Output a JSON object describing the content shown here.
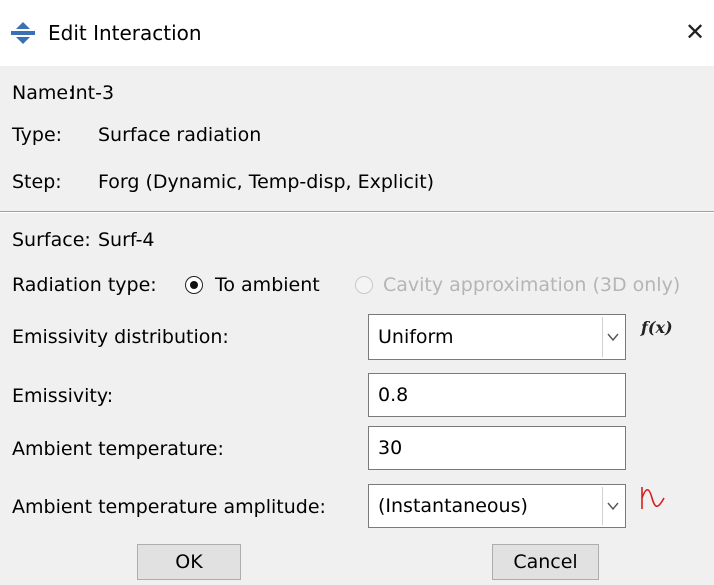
{
  "window": {
    "title": "Edit Interaction",
    "close_glyph": "✕",
    "icon": "interaction-icon"
  },
  "info": {
    "name_label": "Name:",
    "name_value": "Int-3",
    "type_label": "Type:",
    "type_value": "Surface radiation",
    "step_label": "Step:",
    "step_value": "Forg (Dynamic, Temp-disp, Explicit)"
  },
  "surface": {
    "label": "Surface:",
    "value": "Surf-4"
  },
  "radiation_type": {
    "label": "Radiation type:",
    "options": [
      {
        "label": "To ambient",
        "checked": true,
        "enabled": true
      },
      {
        "label": "Cavity approximation (3D only)",
        "checked": false,
        "enabled": false
      }
    ]
  },
  "fields": {
    "emissivity_distribution_label": "Emissivity distribution:",
    "emissivity_distribution_value": "Uniform",
    "fx_label": "f(x)",
    "emissivity_label": "Emissivity:",
    "emissivity_value": "0.8",
    "ambient_temperature_label": "Ambient temperature:",
    "ambient_temperature_value": "30",
    "ambient_amplitude_label": "Ambient temperature amplitude:",
    "ambient_amplitude_value": "(Instantaneous)"
  },
  "buttons": {
    "ok_label": "OK",
    "cancel_label": "Cancel"
  },
  "colors": {
    "background": "#f0f0f0",
    "title_bar": "#ffffff",
    "amplitude_icon": "#d81e1e",
    "disabled_text": "#b5b5b5"
  }
}
